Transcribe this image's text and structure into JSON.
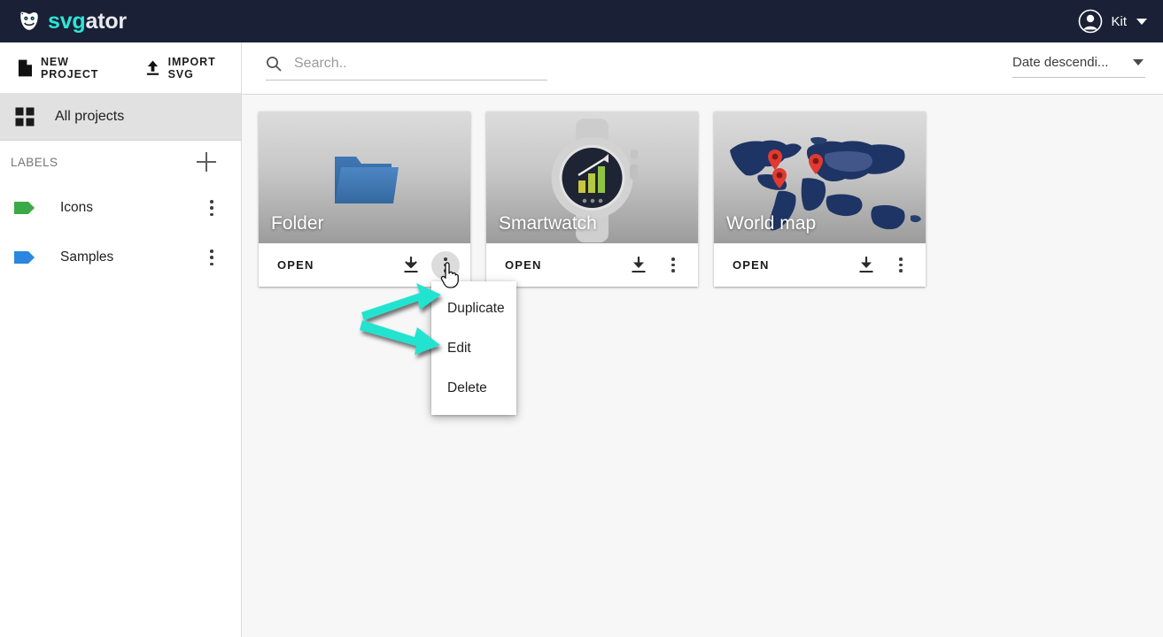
{
  "app": {
    "brand_accent_text": "svg",
    "brand_rest_text": "ator",
    "brand_icon": "svgator-mask-icon",
    "accent_color": "#2ce6d8",
    "header_color": "#1a2035"
  },
  "account": {
    "name": "Kit",
    "avatar_icon": "user-avatar-icon",
    "caret_icon": "chevron-down-icon"
  },
  "sidebar": {
    "actions": [
      {
        "label": "NEW PROJECT",
        "icon": "document-icon"
      },
      {
        "label": "IMPORT SVG",
        "icon": "upload-icon"
      }
    ],
    "all_projects": {
      "label": "All projects",
      "icon": "grid-icon",
      "selected": true
    },
    "labels_section": {
      "title": "LABELS",
      "add_icon": "plus-icon",
      "items": [
        {
          "name": "Icons",
          "color": "#3ba946",
          "menu_icon": "kebab-menu-icon"
        },
        {
          "name": "Samples",
          "color": "#2b86e0",
          "menu_icon": "kebab-menu-icon"
        }
      ]
    }
  },
  "content_header": {
    "search": {
      "placeholder": "Search..",
      "value": "",
      "icon": "search-icon"
    },
    "sort": {
      "value": "Date descendi...",
      "icon": "chevron-down-icon"
    }
  },
  "projects": [
    {
      "title": "Folder",
      "thumbnail": "blue-folder-graphic",
      "open_label": "OPEN",
      "download_icon": "download-icon",
      "menu_icon": "kebab-menu-icon",
      "menu_active": true
    },
    {
      "title": "Smartwatch",
      "thumbnail": "smartwatch-bar-chart-graphic",
      "open_label": "OPEN",
      "download_icon": "download-icon",
      "menu_icon": "kebab-menu-icon",
      "menu_active": false
    },
    {
      "title": "World map",
      "thumbnail": "world-map-pins-graphic",
      "open_label": "OPEN",
      "download_icon": "download-icon",
      "menu_icon": "kebab-menu-icon",
      "menu_active": false
    }
  ],
  "context_menu": {
    "visible": true,
    "items": [
      {
        "label": "Duplicate"
      },
      {
        "label": "Edit"
      },
      {
        "label": "Delete"
      }
    ]
  },
  "annotations": {
    "arrow_color": "#22e3d0",
    "arrows": [
      {
        "target": "card-menu-button",
        "direction": "up-right"
      },
      {
        "target": "menu-item-edit",
        "direction": "down-right"
      }
    ],
    "cursor": "hand-pointer-cursor"
  }
}
